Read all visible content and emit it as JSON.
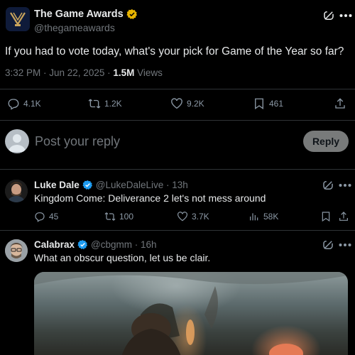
{
  "tweet": {
    "author_name": "The Game Awards",
    "author_handle": "@thegameawards",
    "text": "If you had to vote today, what's your pick for Game of the Year so far?",
    "time": "3:32 PM · Jun 22, 2025 · ",
    "views_count": "1.5M",
    "views_label": " Views",
    "replies": "4.1K",
    "reposts": "1.2K",
    "likes": "9.2K",
    "bookmarks": "461"
  },
  "compose": {
    "placeholder": "Post your reply",
    "button": "Reply"
  },
  "comments": [
    {
      "name": "Luke Dale",
      "handle": "@LukeDaleLive · 13h",
      "text": "Kingdom Come: Deliverance 2 let's not mess around",
      "replies": "45",
      "reposts": "100",
      "likes": "3.7K",
      "views": "58K"
    },
    {
      "name": "Calabrax",
      "handle": "@cbgmm · 16h",
      "text": "What an obscur question, let us be clair."
    }
  ],
  "icons": {
    "verified": "verified-badge-icon",
    "grok": "grok-icon",
    "more": "more-icon",
    "reply": "reply-icon",
    "repost": "repost-icon",
    "like": "like-icon",
    "bookmark": "bookmark-icon",
    "share": "share-icon",
    "views": "views-icon"
  },
  "colors": {
    "background": "#000000",
    "verified_blue": "#1d9bf0",
    "gold_badge": "#e8b400",
    "muted": "#71767b"
  }
}
